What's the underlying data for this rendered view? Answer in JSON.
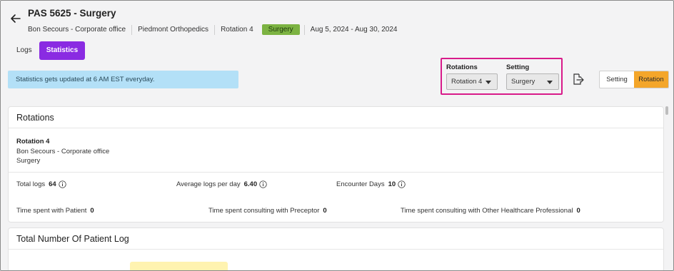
{
  "header": {
    "title": "PAS 5625 - Surgery",
    "meta": [
      "Bon Secours - Corporate office",
      "Piedmont Orthopedics",
      "Rotation 4"
    ],
    "badge": "Surgery",
    "date_range": "Aug 5, 2024 - Aug 30, 2024"
  },
  "tabs": [
    {
      "label": "Logs",
      "active": false
    },
    {
      "label": "Statistics",
      "active": true
    }
  ],
  "banner": "Statistics gets updated at 6 AM EST everyday.",
  "filters": {
    "rotations_label": "Rotations",
    "rotations_value": "Rotation 4",
    "setting_label": "Setting",
    "setting_value": "Surgery"
  },
  "toggle": {
    "setting": "Setting",
    "rotation": "Rotation",
    "active": "Rotation"
  },
  "rotations_card": {
    "title": "Rotations",
    "rotation_name": "Rotation 4",
    "site": "Bon Secours - Corporate office",
    "setting": "Surgery",
    "stats": {
      "total_logs_label": "Total logs",
      "total_logs": "64",
      "avg_logs_label": "Average logs per day",
      "avg_logs": "6.40",
      "encounter_label": "Encounter Days",
      "encounter": "10",
      "time_patient_label": "Time spent with Patient",
      "time_patient": "0",
      "time_preceptor_label": "Time spent consulting with Preceptor",
      "time_preceptor": "0",
      "time_other_label": "Time spent consulting with Other Healthcare Professional",
      "time_other": "0"
    }
  },
  "patient_log_card": {
    "title": "Total Number Of Patient Log"
  },
  "colors": {
    "accent_purple": "#8a2be2",
    "badge_green": "#7cb342",
    "highlight_magenta": "#d81b8a",
    "toggle_orange": "#f4a62a",
    "banner_blue": "#b3e0f7"
  }
}
